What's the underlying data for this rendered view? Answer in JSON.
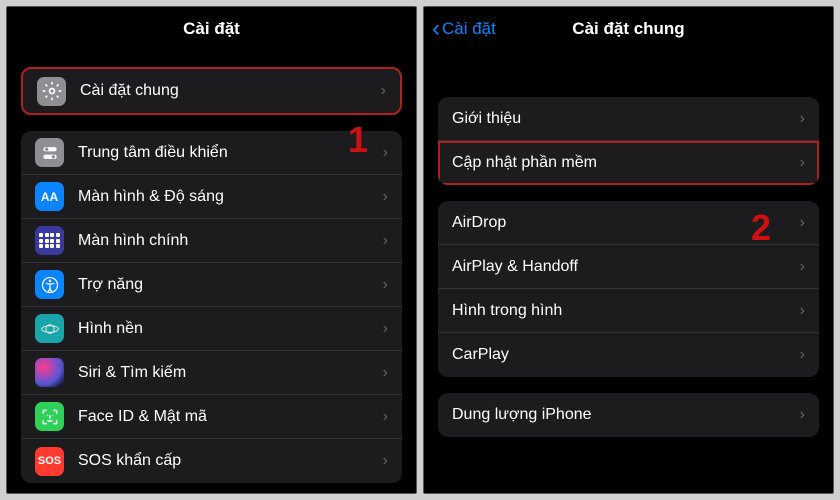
{
  "left": {
    "title": "Cài đặt",
    "annotation": "1",
    "items": [
      {
        "label": "Cài đặt chung",
        "icon": "gear-icon",
        "iconClass": "ico-general",
        "highlight": true
      },
      {
        "label": "Trung tâm điều khiển",
        "icon": "switches-icon",
        "iconClass": "ico-control"
      },
      {
        "label": "Màn hình & Độ sáng",
        "icon": "display-icon",
        "iconClass": "ico-display"
      },
      {
        "label": "Màn hình chính",
        "icon": "home-icon",
        "iconClass": "ico-home"
      },
      {
        "label": "Trợ năng",
        "icon": "accessibility-icon",
        "iconClass": "ico-accessibility"
      },
      {
        "label": "Hình nền",
        "icon": "wallpaper-icon",
        "iconClass": "ico-wallpaper"
      },
      {
        "label": "Siri & Tìm kiếm",
        "icon": "siri-icon",
        "iconClass": "ico-siri"
      },
      {
        "label": "Face ID & Mật mã",
        "icon": "faceid-icon",
        "iconClass": "ico-faceid"
      },
      {
        "label": "SOS khẩn cấp",
        "icon": "sos-icon",
        "iconClass": "ico-sos"
      }
    ]
  },
  "right": {
    "title": "Cài đặt chung",
    "back": "Cài đặt",
    "annotation": "2",
    "groups": [
      {
        "items": [
          {
            "label": "Giới thiệu"
          },
          {
            "label": "Cập nhật phần mềm",
            "highlight": true
          }
        ]
      },
      {
        "items": [
          {
            "label": "AirDrop"
          },
          {
            "label": "AirPlay & Handoff"
          },
          {
            "label": "Hình trong hình"
          },
          {
            "label": "CarPlay"
          }
        ]
      },
      {
        "items": [
          {
            "label": "Dung lượng iPhone"
          }
        ]
      }
    ]
  },
  "icon_text": {
    "display": "AA",
    "sos": "SOS"
  }
}
